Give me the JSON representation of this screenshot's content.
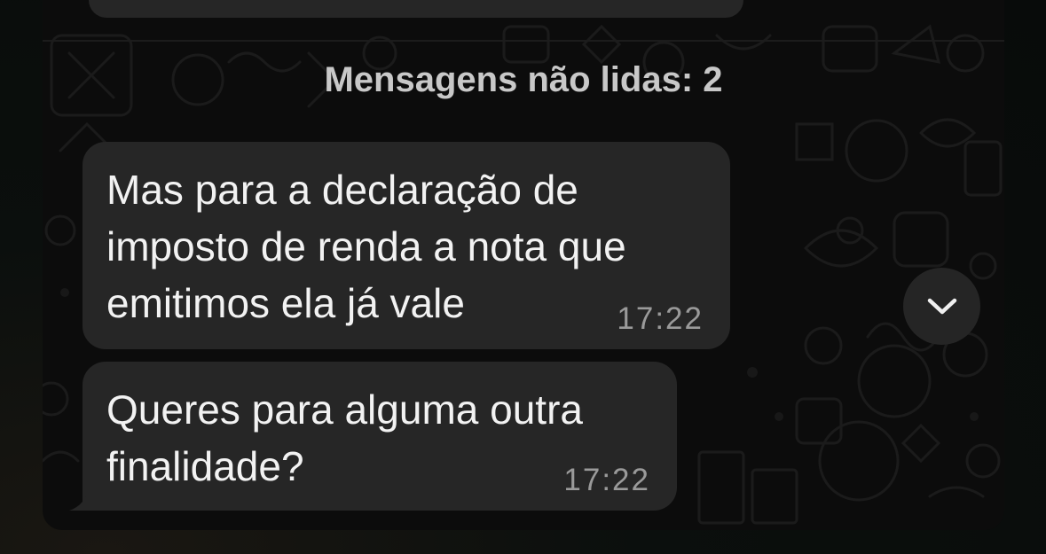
{
  "chat": {
    "unread_divider": "Mensagens não lidas: 2",
    "messages": [
      {
        "text": "Mas para a declaração de\nimposto de renda a nota que\nemitimos ela já vale",
        "time": "17:22"
      },
      {
        "text": "Queres para alguma outra\nfinalidade?",
        "time": "17:22"
      }
    ],
    "scroll_button_icon": "chevron-down-icon"
  },
  "colors": {
    "bubble_background": "#262626",
    "message_text": "#f2f2f2",
    "timestamp": "#9a9a9a",
    "divider_text": "#c8c8c8",
    "panel_background": "#0c0c0c"
  }
}
